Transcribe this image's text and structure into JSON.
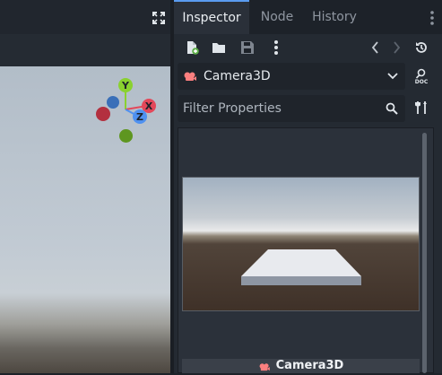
{
  "tabs": [
    {
      "label": "Inspector",
      "active": true
    },
    {
      "label": "Node",
      "active": false
    },
    {
      "label": "History",
      "active": false
    }
  ],
  "toolbar": {
    "icons": [
      "new-resource-icon",
      "open-resource-icon",
      "save-resource-icon",
      "more-options-icon",
      "history-back-icon",
      "history-forward-icon",
      "object-history-icon"
    ]
  },
  "object_selector": {
    "name": "Camera3D",
    "icon": "camera3d-icon",
    "doc_label": "DOC"
  },
  "filter": {
    "placeholder": "Filter Properties"
  },
  "gizmo": {
    "y_label": "Y",
    "x_label": "X",
    "z_label": "Z",
    "colors": {
      "x": "#e3485a",
      "y": "#8ad12f",
      "z": "#4f91f0"
    }
  },
  "preview": {
    "camera_label": "Camera3D"
  },
  "colors": {
    "accent": "#5a9cf0",
    "camera_icon": "#fc7f7f"
  }
}
